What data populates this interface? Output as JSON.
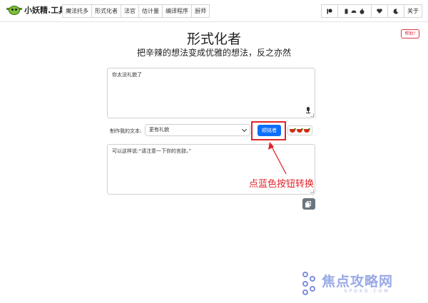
{
  "brand": {
    "name": "小妖精.工具"
  },
  "nav": {
    "tabs": [
      "魔法托多",
      "形式化者",
      "法官",
      "估计量",
      "编译程序",
      "厨师"
    ],
    "about_label": "关于"
  },
  "help_label": "帮助?",
  "page": {
    "title": "形式化者",
    "subtitle": "把辛辣的想法变成优雅的想法，反之亦然"
  },
  "input": {
    "value": "你太没礼貌了"
  },
  "controls": {
    "label": "制作我的文本:",
    "select_value": "更有礼貌",
    "convert_label": "顺铭者"
  },
  "output": {
    "value": "可以这样说:“请注意一下你的言辞。”"
  },
  "annotation": {
    "text": "点蓝色按钮转换",
    "color": "#e0242b"
  },
  "watermark": {
    "main": "焦点攻略网",
    "sub": "GPGXD.COM"
  },
  "colors": {
    "primary": "#0d6efd",
    "danger": "#dc3545",
    "secondary": "#6c757d"
  }
}
